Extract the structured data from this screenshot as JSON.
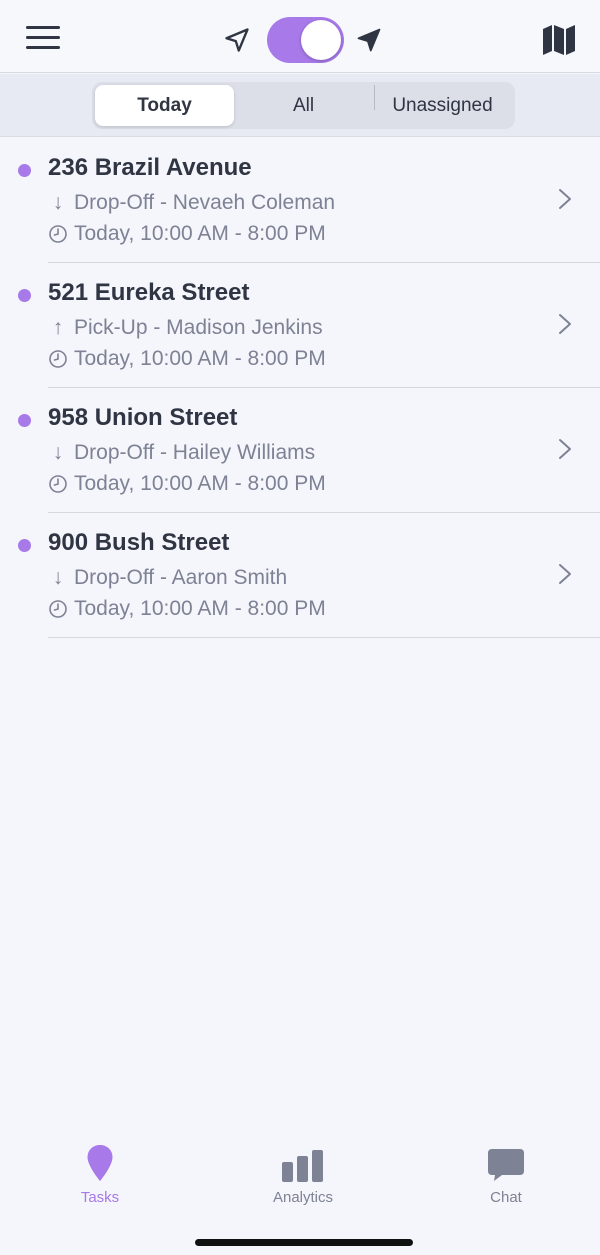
{
  "header": {
    "menu_icon": "hamburger-menu-icon",
    "toggle_on": true,
    "location_off_icon": "navigation-arrow-outline-icon",
    "location_on_icon": "navigation-arrow-filled-icon",
    "map_icon": "folded-map-icon"
  },
  "segments": {
    "today": "Today",
    "all": "All",
    "unassigned": "Unassigned",
    "selected": "Today"
  },
  "tasks": [
    {
      "address": "236 Brazil Avenue",
      "direction_glyph": "↓",
      "type_line": "Drop-Off - Nevaeh Coleman",
      "time": "Today, 10:00 AM - 8:00 PM"
    },
    {
      "address": "521 Eureka Street",
      "direction_glyph": "↑",
      "type_line": "Pick-Up - Madison Jenkins",
      "time": "Today, 10:00 AM - 8:00 PM"
    },
    {
      "address": "958 Union Street",
      "direction_glyph": "↓",
      "type_line": "Drop-Off - Hailey Williams",
      "time": "Today, 10:00 AM - 8:00 PM"
    },
    {
      "address": "900 Bush Street",
      "direction_glyph": "↓",
      "type_line": "Drop-Off - Aaron Smith",
      "time": "Today, 10:00 AM - 8:00 PM"
    }
  ],
  "tabbar": {
    "tasks": "Tasks",
    "analytics": "Analytics",
    "chat": "Chat",
    "active": "Tasks"
  },
  "colors": {
    "accent": "#a779e9",
    "text_primary": "#2f3542",
    "text_secondary": "#7d8294",
    "background": "#f5f6fb"
  }
}
